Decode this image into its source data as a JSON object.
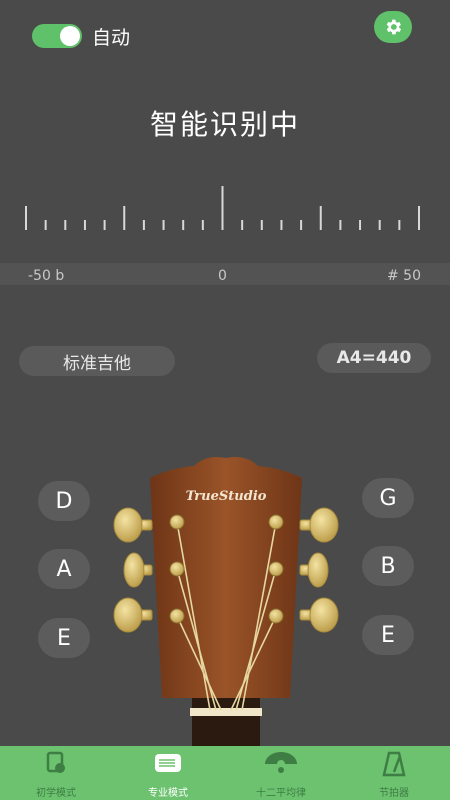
{
  "header": {
    "auto_label": "自动",
    "auto_enabled": true,
    "settings_icon": "gear-icon"
  },
  "status": {
    "title": "智能识别中"
  },
  "meter": {
    "left_label": "-50 b",
    "center_label": "0",
    "right_label": "# 50"
  },
  "tuning_selector": {
    "label": "标准吉他"
  },
  "reference_pitch": {
    "label": "A4=440"
  },
  "strings": {
    "left": [
      "D",
      "A",
      "E"
    ],
    "right": [
      "G",
      "B",
      "E"
    ]
  },
  "headstock": {
    "brand": "TrueStudio"
  },
  "nav": {
    "items": [
      {
        "label": "初学模式",
        "icon": "beginner-mode-icon",
        "active": false
      },
      {
        "label": "专业模式",
        "icon": "pro-mode-icon",
        "active": true
      },
      {
        "label": "十二平均律",
        "icon": "fan-scale-icon",
        "active": false
      },
      {
        "label": "节拍器",
        "icon": "metronome-icon",
        "active": false
      }
    ]
  },
  "colors": {
    "accent": "#6cc26f",
    "background": "#4a4a4a",
    "headstock": "#8a4a22",
    "peg": "#d9c27a"
  }
}
